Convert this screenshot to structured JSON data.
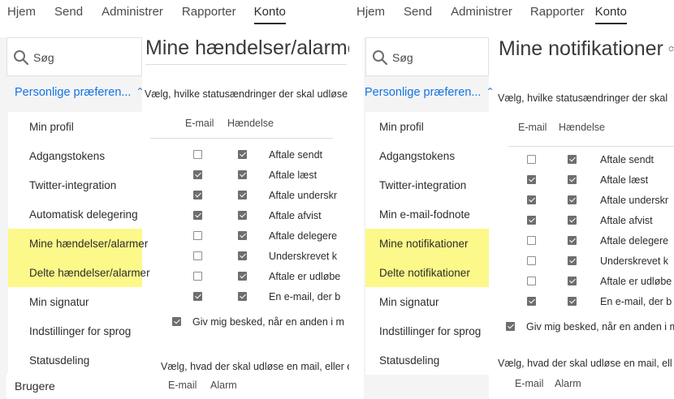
{
  "left": {
    "nav": [
      "Hjem",
      "Send",
      "Administrer",
      "Rapporter",
      "Konto"
    ],
    "search_placeholder": "Søg",
    "section": "Personlige præferen...",
    "menu": [
      {
        "label": "Min profil",
        "highlighted": false
      },
      {
        "label": "Adgangstokens",
        "highlighted": false
      },
      {
        "label": "Twitter-integration",
        "highlighted": false
      },
      {
        "label": "Automatisk delegering",
        "highlighted": false
      },
      {
        "label": "Mine hændelser/alarmer",
        "highlighted": true
      },
      {
        "label": "Delte hændelser/alarmer",
        "highlighted": true
      },
      {
        "label": "Min signatur",
        "highlighted": false
      },
      {
        "label": "Indstillinger for sprog",
        "highlighted": false
      },
      {
        "label": "Statusdeling",
        "highlighted": false
      }
    ],
    "footer": "Brugere",
    "title": "Mine hændelser/alarmer",
    "instruction": "Vælg, hvilke statusændringer der skal udløse e",
    "col_email": "E-mail",
    "col_event": "Hændelse",
    "rows": [
      {
        "email": false,
        "event": true,
        "label": "Aftale sendt"
      },
      {
        "email": true,
        "event": true,
        "label": "Aftale læst"
      },
      {
        "email": true,
        "event": true,
        "label": "Aftale underskr"
      },
      {
        "email": true,
        "event": true,
        "label": "Aftale afvist"
      },
      {
        "email": false,
        "event": true,
        "label": "Aftale delegere"
      },
      {
        "email": false,
        "event": true,
        "label": "Underskrevet k"
      },
      {
        "email": false,
        "event": true,
        "label": "Aftale er udløbe"
      },
      {
        "email": true,
        "event": true,
        "label": "En e-mail, der b"
      }
    ],
    "notify_checked": true,
    "notify_label": "Giv mig besked, når en anden i m",
    "instruction2": "Vælg, hvad der skal udløse en mail, eller opret",
    "col_email2": "E-mail",
    "col_alarm": "Alarm"
  },
  "right": {
    "nav": [
      "Hjem",
      "Send",
      "Administrer",
      "Rapporter",
      "Konto"
    ],
    "search_placeholder": "Søg",
    "section": "Personlige præferen...",
    "menu": [
      {
        "label": "Min profil",
        "highlighted": false
      },
      {
        "label": "Adgangstokens",
        "highlighted": false
      },
      {
        "label": "Twitter-integration",
        "highlighted": false
      },
      {
        "label": "Min e-mail-fodnote",
        "highlighted": false
      },
      {
        "label": "Mine notifikationer",
        "highlighted": true
      },
      {
        "label": "Delte notifikationer",
        "highlighted": true
      },
      {
        "label": "Min signatur",
        "highlighted": false
      },
      {
        "label": "Indstillinger for sprog",
        "highlighted": false
      },
      {
        "label": "Statusdeling",
        "highlighted": false
      }
    ],
    "title": "Mine notifikationer",
    "instruction": "Vælg, hvilke statusændringer der skal",
    "col_email": "E-mail",
    "col_event": "Hændelse",
    "rows": [
      {
        "email": false,
        "event": true,
        "label": "Aftale sendt"
      },
      {
        "email": true,
        "event": true,
        "label": "Aftale læst"
      },
      {
        "email": true,
        "event": true,
        "label": "Aftale underskr"
      },
      {
        "email": true,
        "event": true,
        "label": "Aftale afvist"
      },
      {
        "email": false,
        "event": true,
        "label": "Aftale delegere"
      },
      {
        "email": false,
        "event": true,
        "label": "Underskrevet k"
      },
      {
        "email": false,
        "event": true,
        "label": "Aftale er udløbe"
      },
      {
        "email": true,
        "event": true,
        "label": "En e-mail, der b"
      }
    ],
    "notify_checked": true,
    "notify_label": "Giv mig besked, når en anden i m",
    "instruction2": "Vælg, hvad der skal udløse en mail, ell",
    "col_email2": "E-mail",
    "col_alarm": "Alarm"
  },
  "colors": {
    "accent": "#1473e6",
    "highlight": "#fcf889",
    "sidebar_bg": "#f4f4f4"
  },
  "icons": [
    "search-icon",
    "chevron-up-icon",
    "refresh-icon"
  ]
}
